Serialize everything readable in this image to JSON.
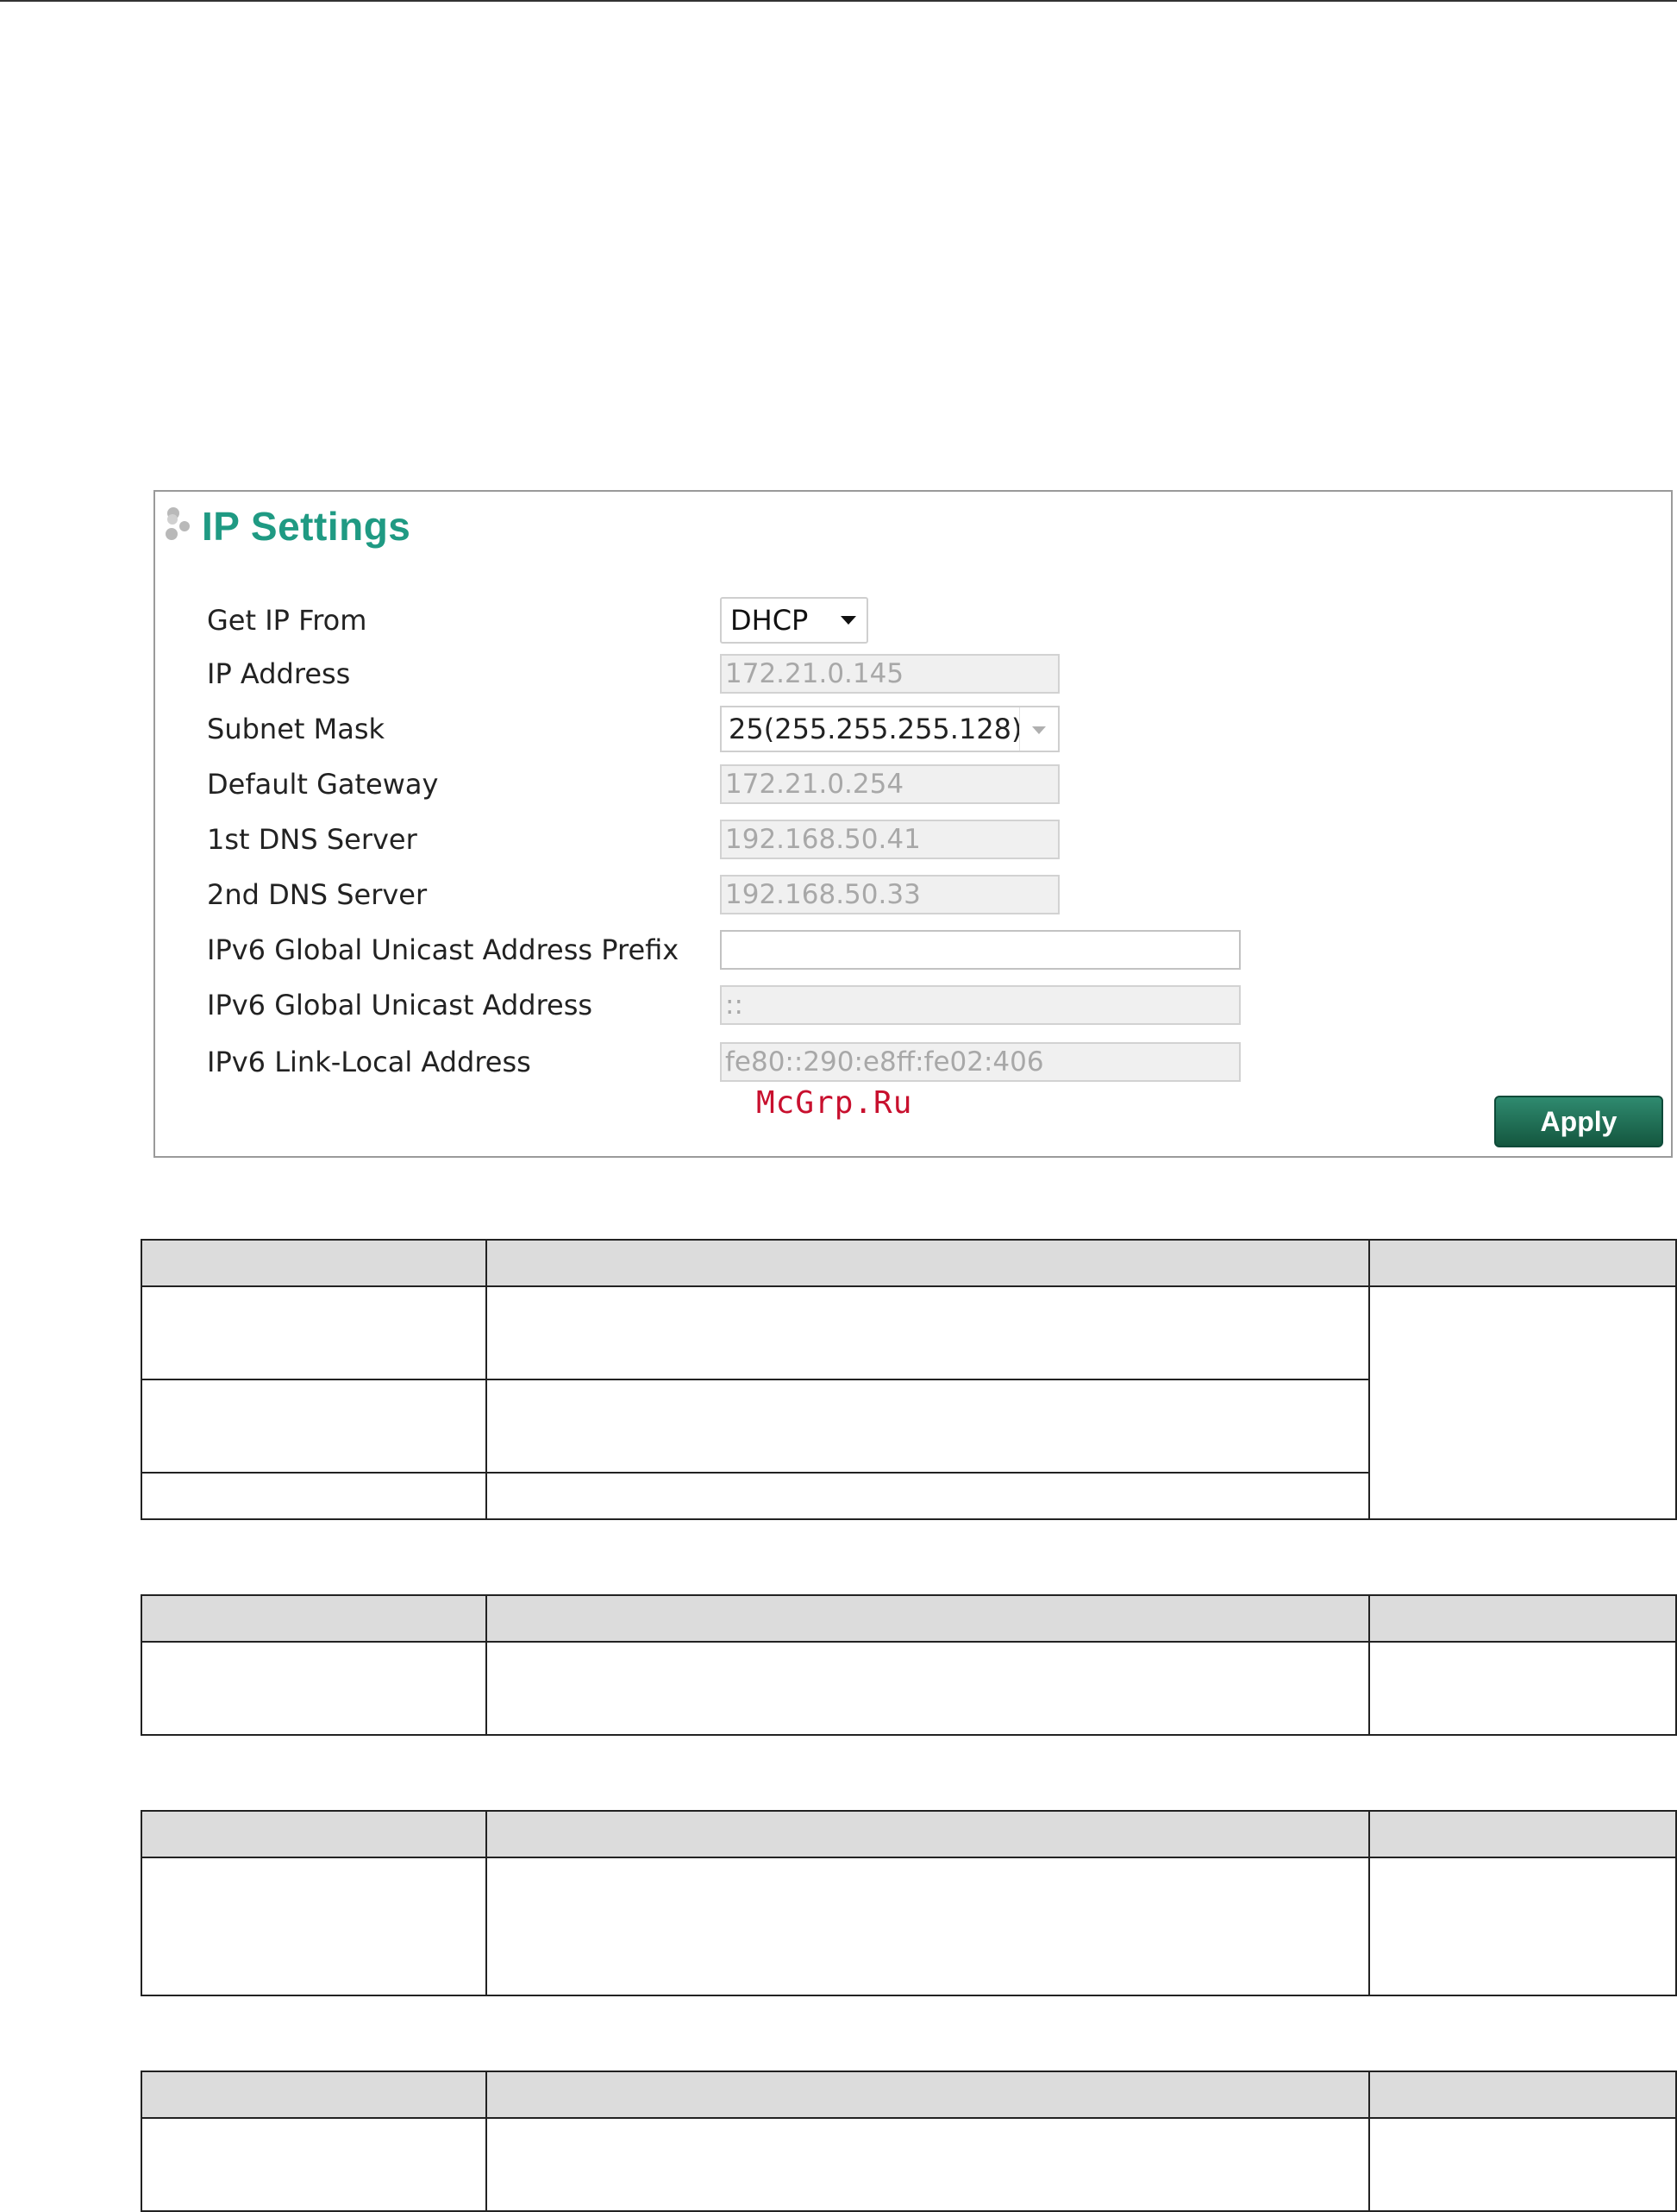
{
  "panel": {
    "title": "IP Settings",
    "fields": {
      "get_ip_from": {
        "label": "Get IP From",
        "value": "DHCP"
      },
      "ip_address": {
        "label": "IP Address",
        "value": "172.21.0.145"
      },
      "subnet_mask": {
        "label": "Subnet Mask",
        "value": "25(255.255.255.128)"
      },
      "default_gateway": {
        "label": "Default Gateway",
        "value": "172.21.0.254"
      },
      "dns1": {
        "label": "1st DNS Server",
        "value": "192.168.50.41"
      },
      "dns2": {
        "label": "2nd DNS Server",
        "value": "192.168.50.33"
      },
      "ipv6_prefix": {
        "label": "IPv6 Global Unicast Address Prefix",
        "value": ""
      },
      "ipv6_global": {
        "label": "IPv6 Global Unicast Address",
        "value": "::"
      },
      "ipv6_link_local": {
        "label": "IPv6 Link-Local Address",
        "value": "fe80::290:e8ff:fe02:406"
      }
    },
    "apply_label": "Apply"
  },
  "watermark": "McGrp.Ru",
  "colors": {
    "title_teal": "#1f9a83",
    "apply_green": "#14573f",
    "watermark_red": "#c8102e",
    "table_header_gray": "#dcdcdc"
  },
  "icons": {
    "title_bullet": "dots-icon",
    "dropdown": "chevron-down-icon"
  }
}
